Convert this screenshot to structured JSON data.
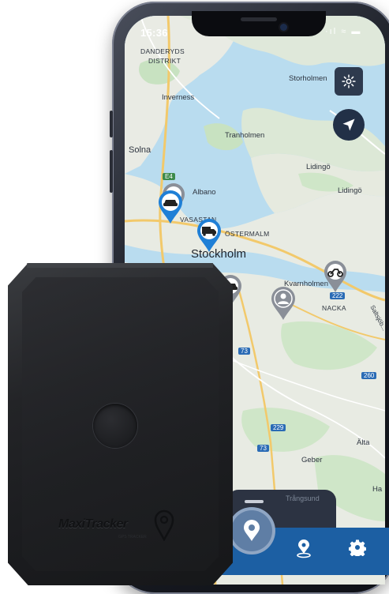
{
  "status_bar": {
    "time": "15:36",
    "icons": "·ıl ≈ ▬"
  },
  "map": {
    "labels": {
      "danderyd": "DANDERYDS",
      "distrikt": "DISTRIKT",
      "storholmen": "Storholmen",
      "inverness": "Inverness",
      "tranholmen": "Tranholmen",
      "solna": "Solna",
      "lidingo1": "Lidingö",
      "lidingo2": "Lidingö",
      "albano": "Albano",
      "vasastan": "VASASTAN",
      "ostermalm": "ÖSTERMALM",
      "stockholm": "Stockholm",
      "kvarnholmen": "Kvarnholmen",
      "nacka": "NACKA",
      "saltsjobaden": "Saltsjöb...",
      "alta": "Älta",
      "geber": "Geber",
      "trangsund": "Trångsund",
      "ha": "Ha"
    },
    "routes": {
      "e4": "E4",
      "r73a": "73",
      "r73b": "73",
      "r222": "222",
      "r229": "229",
      "r260": "260"
    }
  },
  "controls": {
    "settings_icon": "gear-icon",
    "locate_icon": "navigation-arrow-icon"
  },
  "markers": [
    {
      "kind": "car",
      "icon": "car-icon",
      "color": "#1f7fd6"
    },
    {
      "kind": "truck",
      "icon": "truck-icon",
      "color": "#1f7fd6"
    },
    {
      "kind": "car",
      "icon": "car-icon",
      "color": "#8a8f98"
    },
    {
      "kind": "person",
      "icon": "person-icon",
      "color": "#8a8f98"
    },
    {
      "kind": "motorcycle",
      "icon": "motorcycle-icon",
      "color": "#8a8f98"
    }
  ],
  "bottom_nav": {
    "items": [
      {
        "name": "map-view",
        "icon": "map-pin-icon",
        "active": true
      },
      {
        "name": "locations",
        "icon": "location-pin-icon",
        "active": false
      },
      {
        "name": "settings",
        "icon": "gear-icon",
        "active": false
      }
    ]
  },
  "device": {
    "logo": "MaxiTracker",
    "logo_sub": "GPS TRACKER"
  },
  "colors": {
    "accent": "#1c5fa3",
    "map_water": "#b9dcef",
    "map_land": "#e8ebe3",
    "device": "#1f2023"
  }
}
